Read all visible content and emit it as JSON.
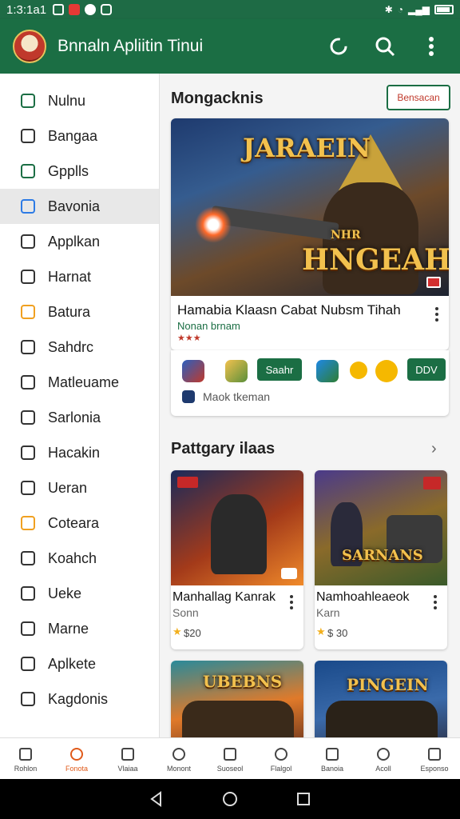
{
  "status_bar": {
    "time": "1:3:1a1"
  },
  "app_bar": {
    "title": "Bnnaln Apliitin Tinui"
  },
  "sidebar": {
    "items": [
      {
        "label": "Nulnu",
        "icon": "search-icon",
        "color": "#1b6e44"
      },
      {
        "label": "Bangaa",
        "icon": "chart-icon",
        "color": "#333333"
      },
      {
        "label": "Gpplls",
        "icon": "search-icon",
        "color": "#1b6e44"
      },
      {
        "label": "Bavonia",
        "icon": "apps-icon",
        "color": "#2d7be5",
        "active": true
      },
      {
        "label": "Applkan",
        "icon": "mail-icon",
        "color": "#333333"
      },
      {
        "label": "Harnat",
        "icon": "star-icon",
        "color": "#333333"
      },
      {
        "label": "Batura",
        "icon": "badge-icon",
        "color": "#f0a020"
      },
      {
        "label": "Sahdrc",
        "icon": "flag-icon",
        "color": "#333333"
      },
      {
        "label": "Matleuame",
        "icon": "puzzle-icon",
        "color": "#333333"
      },
      {
        "label": "Sarlonia",
        "icon": "box-icon",
        "color": "#333333"
      },
      {
        "label": "Hacakin",
        "icon": "list-icon",
        "color": "#333333"
      },
      {
        "label": "Ueran",
        "icon": "envelope-icon",
        "color": "#333333"
      },
      {
        "label": "Coteara",
        "icon": "folder-icon",
        "color": "#f0a020"
      },
      {
        "label": "Koahch",
        "icon": "compass-icon",
        "color": "#333333"
      },
      {
        "label": "Ueke",
        "icon": "clock-icon",
        "color": "#333333"
      },
      {
        "label": "Marne",
        "icon": "camera-icon",
        "color": "#333333"
      },
      {
        "label": "Aplkete",
        "icon": "cross-icon",
        "color": "#333333"
      },
      {
        "label": "Kagdonis",
        "icon": "image-icon",
        "color": "#333333"
      }
    ]
  },
  "main": {
    "section1_title": "Mongacknis",
    "section1_button": "Bensacan",
    "featured": {
      "art_title": "JARAEIN",
      "art_subtitle": "NHR",
      "art_logo": "HNGEAH",
      "title": "Hamabia Klaasn Cabat Nubsm Tihah",
      "subtitle": "Nonan brnam",
      "stars": "★★★",
      "action1": "Saahr",
      "action2": "DDV",
      "footer_text": "Maok tkeman"
    },
    "section2_title": "Pattgary ilaas",
    "games": [
      {
        "title": "Manhallag Kanrak",
        "subtitle": "Sonn",
        "price": "$20",
        "art_text": ""
      },
      {
        "title": "Namhoahleaeok",
        "subtitle": "Karn",
        "price": "$ 30",
        "art_text": "SARNANS"
      },
      {
        "title": "",
        "subtitle": "",
        "price": "",
        "art_text": "UBEBNS"
      },
      {
        "title": "",
        "subtitle": "",
        "price": "",
        "art_text": "PINGEIN"
      }
    ]
  },
  "bottom_nav": {
    "items": [
      {
        "label": "Rohlon",
        "icon": "home-icon"
      },
      {
        "label": "Fonota",
        "icon": "house-outline-icon",
        "active": true
      },
      {
        "label": "Vlaiaa",
        "icon": "compass-icon"
      },
      {
        "label": "Monont",
        "icon": "calendar-icon"
      },
      {
        "label": "Suoseol",
        "icon": "search-icon"
      },
      {
        "label": "Flalgol",
        "icon": "document-icon"
      },
      {
        "label": "Banoia",
        "icon": "inbox-icon"
      },
      {
        "label": "Acoll",
        "icon": "mic-icon"
      },
      {
        "label": "Esponso",
        "icon": "person-icon"
      }
    ]
  }
}
